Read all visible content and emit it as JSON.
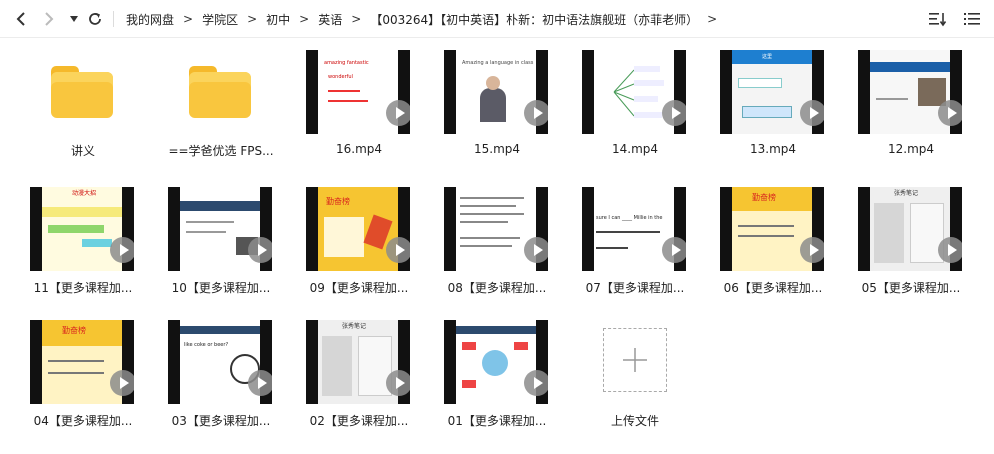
{
  "toolbar": {
    "back_icon": "chevron-left-icon",
    "forward_icon": "chevron-right-icon",
    "history_icon": "caret-down-icon",
    "refresh_icon": "refresh-icon",
    "sort_icon": "sort-icon",
    "list_view_icon": "list-view-icon"
  },
  "breadcrumb": [
    "我的网盘",
    "学院区",
    "初中",
    "英语",
    "【003264】【初中英语】朴新：初中语法旗舰班（亦菲老师）"
  ],
  "items": [
    {
      "type": "folder",
      "label": "讲义"
    },
    {
      "type": "folder",
      "label": "==学爸优选 FPS..."
    },
    {
      "type": "video",
      "label": "16.mp4"
    },
    {
      "type": "video",
      "label": "15.mp4"
    },
    {
      "type": "video",
      "label": "14.mp4"
    },
    {
      "type": "video",
      "label": "13.mp4"
    },
    {
      "type": "video",
      "label": "12.mp4"
    },
    {
      "type": "video",
      "label": "11【更多课程加..."
    },
    {
      "type": "video",
      "label": "10【更多课程加..."
    },
    {
      "type": "video",
      "label": "09【更多课程加..."
    },
    {
      "type": "video",
      "label": "08【更多课程加..."
    },
    {
      "type": "video",
      "label": "07【更多课程加..."
    },
    {
      "type": "video",
      "label": "06【更多课程加..."
    },
    {
      "type": "video",
      "label": "05【更多课程加..."
    },
    {
      "type": "video",
      "label": "04【更多课程加..."
    },
    {
      "type": "video",
      "label": "03【更多课程加..."
    },
    {
      "type": "video",
      "label": "02【更多课程加..."
    },
    {
      "type": "video",
      "label": "01【更多课程加..."
    },
    {
      "type": "upload",
      "label": "上传文件"
    }
  ],
  "thumb_text": {
    "t16": [
      "amazing fantastic",
      "wonderful"
    ],
    "t15": "Amazing a language in class",
    "t13": "这里",
    "t11": "动漫大招",
    "t09": "勤奋榜",
    "t06": "勤奋榜",
    "t05": "张秀笔记",
    "t04": "勤奋榜",
    "t03": "like coke or beer?",
    "t02": "张秀笔记",
    "t07": "sure I can ____ Millie in the"
  },
  "colors": {
    "folder": "#f9c63e",
    "accent_yellow": "#f6c531",
    "accent_red": "#d9281e"
  }
}
